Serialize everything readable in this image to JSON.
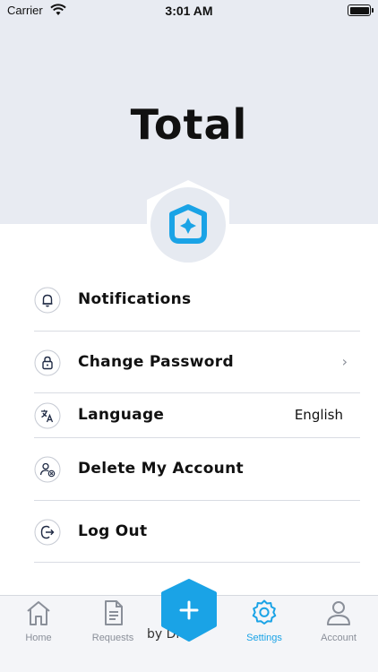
{
  "status_bar": {
    "carrier": "Carrier",
    "time": "3:01 AM"
  },
  "header": {
    "title": "Total"
  },
  "menu": {
    "items": [
      {
        "label": "Notifications",
        "icon": "bell-icon"
      },
      {
        "label": "Change Password",
        "icon": "lock-icon",
        "chevron": "›"
      },
      {
        "label": "Language",
        "icon": "translate-icon",
        "value": "English"
      },
      {
        "label": "Delete My Account",
        "icon": "user-remove-icon"
      },
      {
        "label": "Log Out",
        "icon": "logout-icon"
      }
    ]
  },
  "tabbar": {
    "tabs": [
      {
        "label": "Home",
        "icon": "home-icon"
      },
      {
        "label": "Requests",
        "icon": "document-icon"
      },
      {
        "label": "Settings",
        "icon": "gear-icon",
        "active": true
      },
      {
        "label": "Account",
        "icon": "user-icon"
      }
    ],
    "behind_text": "by Di",
    "fab_symbol": "+"
  },
  "colors": {
    "accent": "#1aa3e6",
    "header_bg": "#e8ebf2",
    "divider": "#d9dce3",
    "inactive": "#8a8f99"
  }
}
